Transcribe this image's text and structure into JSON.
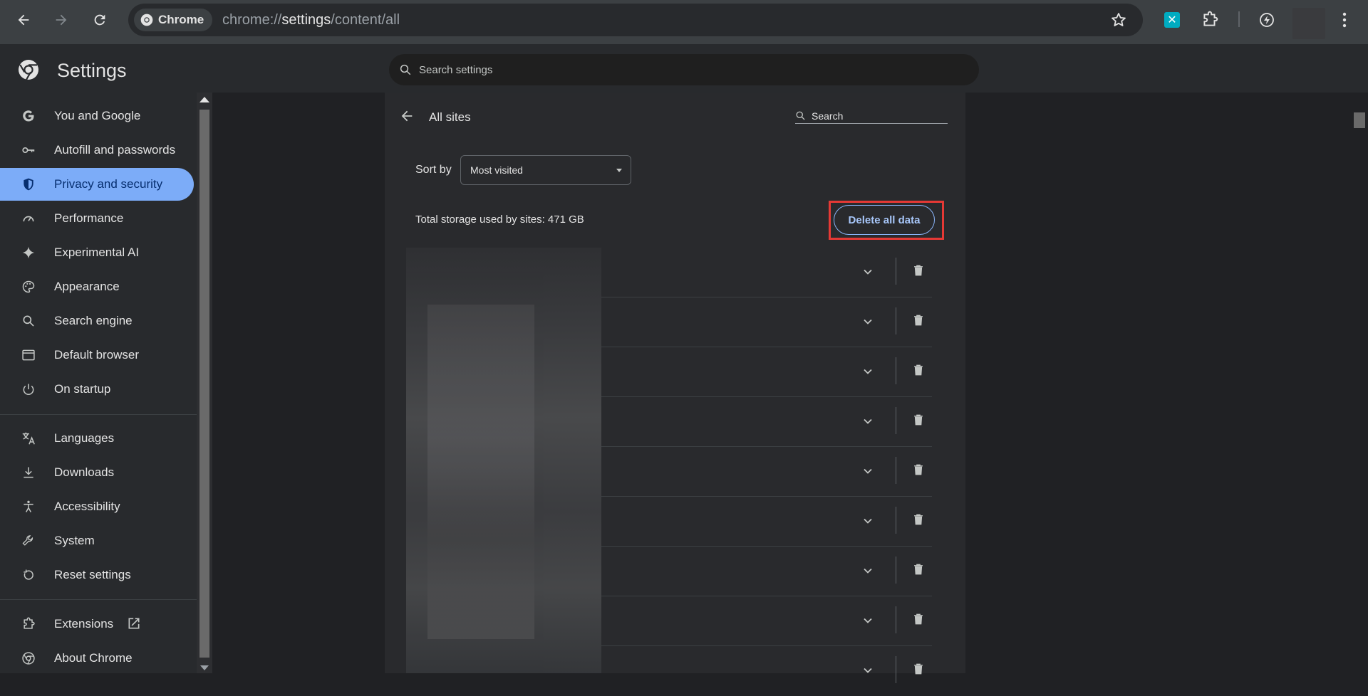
{
  "browser": {
    "chip_label": "Chrome",
    "url_scheme": "chrome://",
    "url_host": "settings",
    "url_path": "/content/all"
  },
  "header": {
    "title": "Settings",
    "search_placeholder": "Search settings"
  },
  "sidebar": {
    "items": [
      {
        "label": "You and Google",
        "icon": "google-g-icon"
      },
      {
        "label": "Autofill and passwords",
        "icon": "key-icon"
      },
      {
        "label": "Privacy and security",
        "icon": "shield-icon",
        "active": true
      },
      {
        "label": "Performance",
        "icon": "speedometer-icon"
      },
      {
        "label": "Experimental AI",
        "icon": "sparkle-icon"
      },
      {
        "label": "Appearance",
        "icon": "palette-icon"
      },
      {
        "label": "Search engine",
        "icon": "search-icon"
      },
      {
        "label": "Default browser",
        "icon": "browser-window-icon"
      },
      {
        "label": "On startup",
        "icon": "power-icon"
      },
      {
        "label": "Languages",
        "icon": "translate-icon"
      },
      {
        "label": "Downloads",
        "icon": "download-icon"
      },
      {
        "label": "Accessibility",
        "icon": "accessibility-icon"
      },
      {
        "label": "System",
        "icon": "wrench-icon"
      },
      {
        "label": "Reset settings",
        "icon": "reset-icon"
      },
      {
        "label": "Extensions",
        "icon": "extensions-icon"
      },
      {
        "label": "About Chrome",
        "icon": "chrome-logo-icon"
      }
    ]
  },
  "content": {
    "page_title": "All sites",
    "search_placeholder": "Search",
    "sort_label": "Sort by",
    "sort_value": "Most visited",
    "storage_text": "Total storage used by sites: 471 GB",
    "delete_all_label": "Delete all data",
    "site_row_count": 9
  },
  "colors": {
    "accent": "#7cacf8",
    "highlight": "#e53935",
    "link": "#a8c7fa"
  }
}
